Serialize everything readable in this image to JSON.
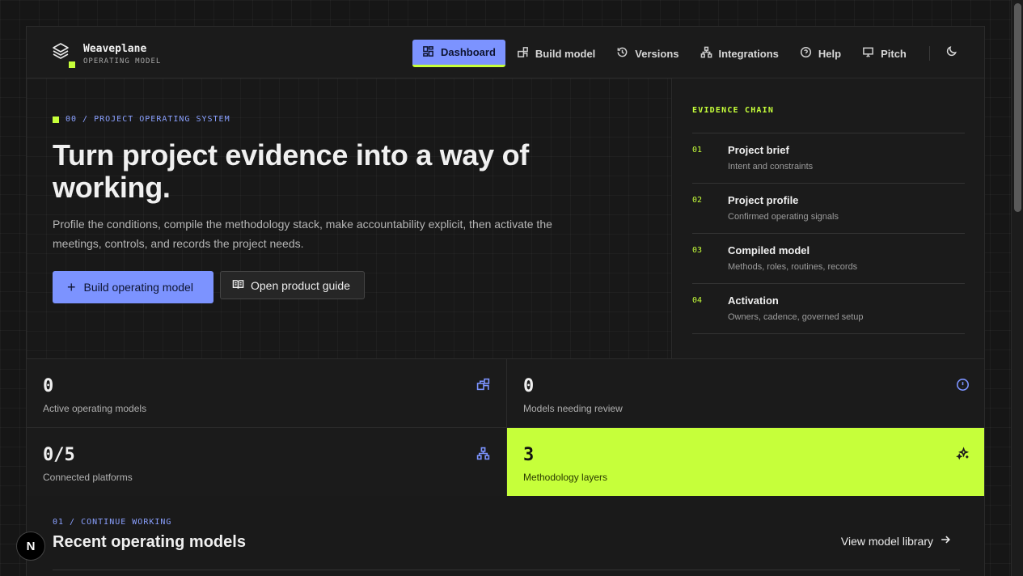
{
  "brand": {
    "name": "Weaveplane",
    "subtitle": "OPERATING MODEL"
  },
  "nav": {
    "items": [
      {
        "label": "Dashboard",
        "icon": "dashboard-icon",
        "active": true
      },
      {
        "label": "Build model",
        "icon": "build-icon"
      },
      {
        "label": "Versions",
        "icon": "history-icon"
      },
      {
        "label": "Integrations",
        "icon": "network-icon"
      },
      {
        "label": "Help",
        "icon": "help-circle-icon"
      },
      {
        "label": "Pitch",
        "icon": "presentation-icon"
      }
    ],
    "theme_toggle_icon": "moon-icon"
  },
  "hero": {
    "eyebrow": "00 / PROJECT OPERATING SYSTEM",
    "title": "Turn project evidence into a way of working.",
    "description": "Profile the conditions, compile the methodology stack, make accountability explicit, then activate the meetings, controls, and records the project needs.",
    "primary_button": "Build operating model",
    "secondary_button": "Open product guide"
  },
  "evidence": {
    "title": "EVIDENCE CHAIN",
    "items": [
      {
        "num": "01",
        "name": "Project brief",
        "sub": "Intent and constraints"
      },
      {
        "num": "02",
        "name": "Project profile",
        "sub": "Confirmed operating signals"
      },
      {
        "num": "03",
        "name": "Compiled model",
        "sub": "Methods, roles, routines, records"
      },
      {
        "num": "04",
        "name": "Activation",
        "sub": "Owners, cadence, governed setup"
      }
    ]
  },
  "stats": [
    {
      "value": "0",
      "label": "Active operating models",
      "icon": "blocks-icon"
    },
    {
      "value": "0",
      "label": "Models needing review",
      "icon": "alert-circle-icon"
    },
    {
      "value": "0/5",
      "label": "Connected platforms",
      "icon": "network-icon"
    },
    {
      "value": "3",
      "label": "Methodology layers",
      "icon": "sparkles-icon",
      "highlight": true
    }
  ],
  "recent": {
    "eyebrow": "01 / CONTINUE WORKING",
    "title": "Recent operating models",
    "link": "View model library"
  },
  "badge": {
    "letter": "N"
  },
  "colors": {
    "accent": "#7c93ff",
    "highlight": "#c6ff3a",
    "background": "#161616"
  }
}
